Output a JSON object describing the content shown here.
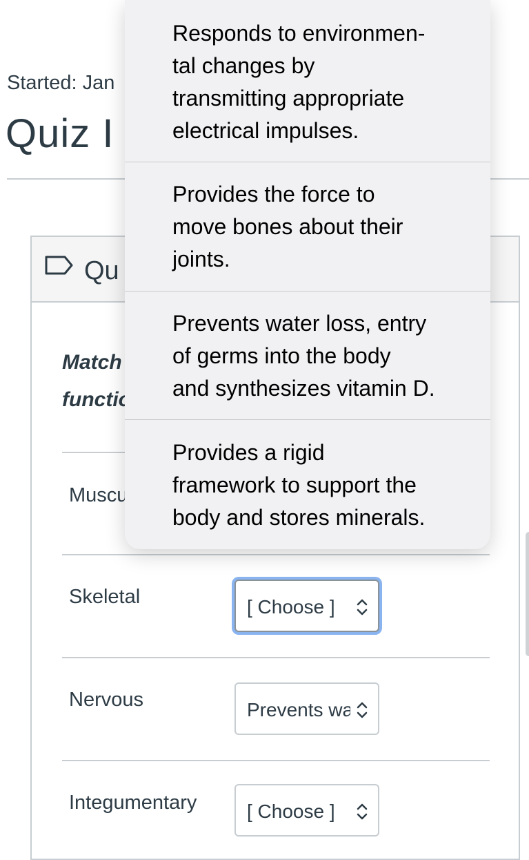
{
  "header": {
    "started": "Started: Jan",
    "title": "Quiz I"
  },
  "question": {
    "label": "Qu",
    "instructions_line1": "Match",
    "instructions_line2": "functio"
  },
  "rows": [
    {
      "label": "Muscu"
    },
    {
      "label": "Skeletal",
      "value": "[ Choose ]"
    },
    {
      "label": "Nervous",
      "value": "Prevents wa"
    },
    {
      "label": "Integumentary",
      "value": "[ Choose ]"
    }
  ],
  "dropdown": {
    "options": [
      "Responds to environmen-\ntal changes by\ntransmitting appropriate\nelectrical impulses.",
      "Provides the force to\nmove bones about their\njoints.",
      "Prevents water loss, entry\nof germs into the body\nand synthesizes vitamin D.",
      "Provides a rigid\nframework to support the\nbody and stores minerals."
    ]
  }
}
